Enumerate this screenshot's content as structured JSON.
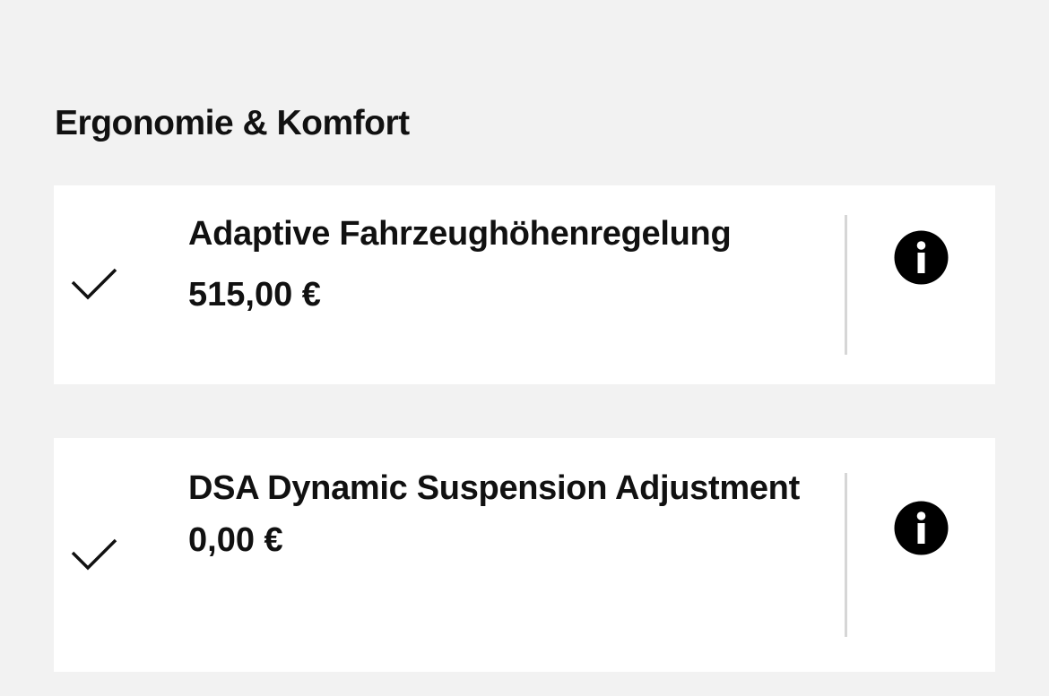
{
  "section": {
    "title": "Ergonomie & Komfort"
  },
  "items": [
    {
      "title": "Adaptive Fahrzeughöhenregelung",
      "price": "515,00 €",
      "selected": true,
      "check_icon": "checkmark-icon",
      "info_icon": "info-icon"
    },
    {
      "title": "DSA Dynamic Suspension Adjustment",
      "price": "0,00 €",
      "selected": true,
      "check_icon": "checkmark-icon",
      "info_icon": "info-icon"
    }
  ],
  "colors": {
    "background": "#f2f2f2",
    "card": "#ffffff",
    "text": "#111111",
    "divider": "#d6d6d6",
    "icon": "#000000"
  }
}
